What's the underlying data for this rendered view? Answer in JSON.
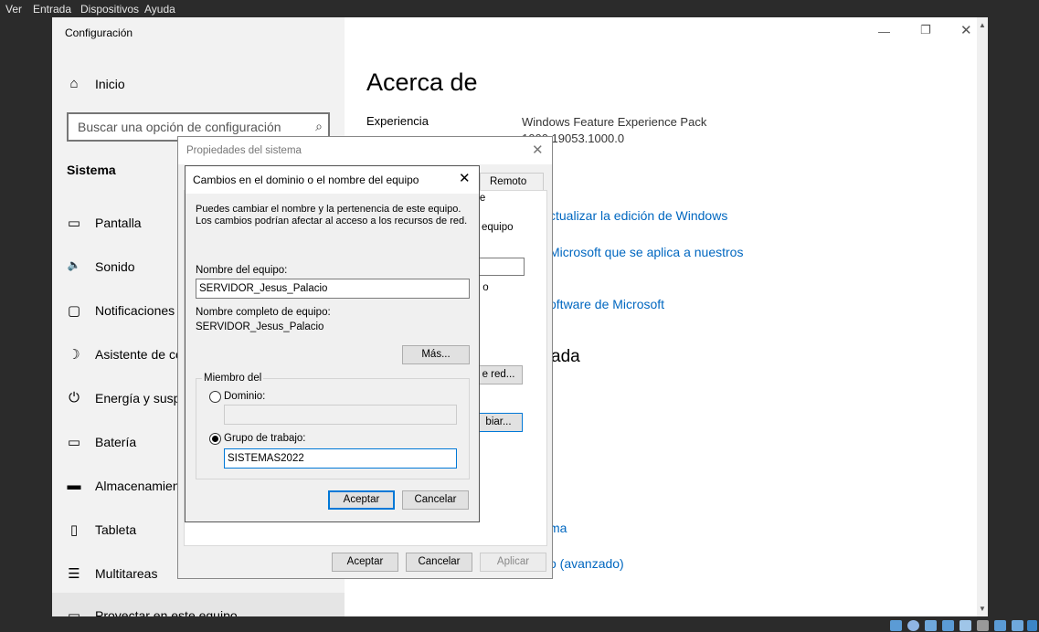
{
  "vm_menu": [
    "Ver",
    "Entrada",
    "Dispositivos",
    "Ayuda"
  ],
  "window": {
    "title": "Configuración"
  },
  "sidebar": {
    "home": "Inicio",
    "search_placeholder": "Buscar una opción de configuración",
    "section": "Sistema",
    "items": [
      {
        "label": "Pantalla",
        "icon": "monitor-icon"
      },
      {
        "label": "Sonido",
        "icon": "speaker-icon"
      },
      {
        "label": "Notificaciones",
        "icon": "notifications-icon"
      },
      {
        "label": "Asistente de co",
        "icon": "moon-icon"
      },
      {
        "label": "Energía y suspe",
        "icon": "power-icon"
      },
      {
        "label": "Batería",
        "icon": "battery-icon"
      },
      {
        "label": "Almacenamien",
        "icon": "storage-icon"
      },
      {
        "label": "Tableta",
        "icon": "tablet-icon"
      },
      {
        "label": "Multitareas",
        "icon": "multitask-icon"
      },
      {
        "label": "Proyectar en este equipo",
        "icon": "project-icon"
      }
    ]
  },
  "main": {
    "title": "Acerca de",
    "exp_label": "Experiencia",
    "exp_value": "Windows Feature Experience Pack",
    "exp_value2": "1000.19053.1000.0",
    "links": [
      "ctualizar la edición de Windows",
      "Microsoft que se aplica a nuestros",
      "oftware de Microsoft",
      "ma",
      "o (avanzado)"
    ],
    "heading_partial": "ada"
  },
  "sysprops": {
    "title": "Propiedades del sistema",
    "tab_remote": "Remoto",
    "tab_partial": "re",
    "partial1": "equipo",
    "partial2": "\" o",
    "btn_red": "e red...",
    "btn_biar": "biar...",
    "ok": "Aceptar",
    "cancel": "Cancelar",
    "apply": "Aplicar"
  },
  "domain_dlg": {
    "title": "Cambios en el dominio o el nombre del equipo",
    "desc": "Puedes cambiar el nombre y la pertenencia de este equipo. Los cambios podrían afectar al acceso a los recursos de red.",
    "name_label": "Nombre del equipo:",
    "name_value": "SERVIDOR_Jesus_Palacio",
    "full_label": "Nombre completo de equipo:",
    "full_value": "SERVIDOR_Jesus_Palacio",
    "more": "Más...",
    "member_of": "Miembro del",
    "domain_label": "Dominio:",
    "domain_value": "",
    "workgroup_label": "Grupo de trabajo:",
    "workgroup_value": "SISTEMAS2022",
    "selected": "workgroup",
    "ok": "Aceptar",
    "cancel": "Cancelar"
  }
}
